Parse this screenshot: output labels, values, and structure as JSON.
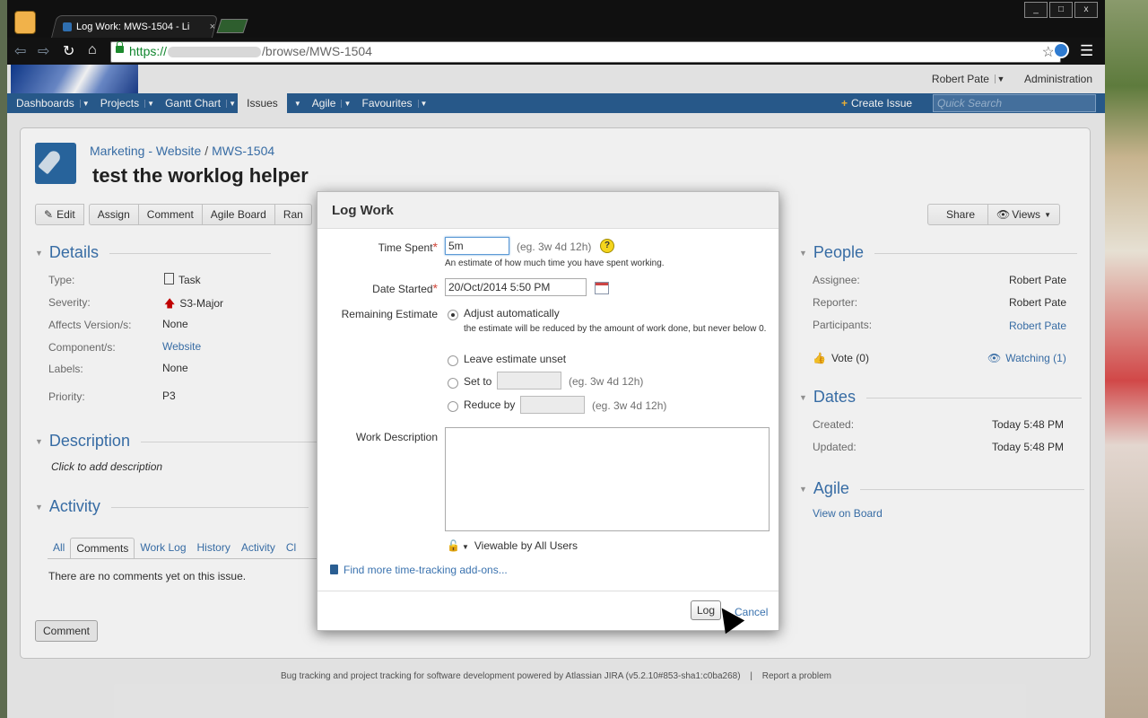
{
  "browser": {
    "tab_title": "Log Work: MWS-1504 - Li",
    "tab_close": "×",
    "url_scheme": "https://",
    "url_path": "/browse/MWS-1504",
    "window_buttons": [
      "_",
      "□",
      "x"
    ]
  },
  "header": {
    "user": "Robert Pate",
    "admin": "Administration",
    "nav": [
      "Dashboards",
      "Projects",
      "Gantt Chart",
      "Issues",
      "Agile",
      "Favourites"
    ],
    "create": "Create Issue",
    "search_placeholder": "Quick Search"
  },
  "issue": {
    "project": "Marketing - Website",
    "key": "MWS-1504",
    "summary": "test the worklog helper",
    "ops": [
      "Edit",
      "Assign",
      "Comment",
      "Agile Board",
      "Ran"
    ],
    "right_ops": [
      "Share",
      "Views"
    ],
    "details_title": "Details",
    "fields": [
      {
        "label": "Type:",
        "value": "Task"
      },
      {
        "label": "Severity:",
        "value": "S3-Major"
      },
      {
        "label": "Affects Version/s:",
        "value": "None"
      },
      {
        "label": "Component/s:",
        "value": "Website"
      },
      {
        "label": "Labels:",
        "value": "None"
      },
      {
        "label": "Priority:",
        "value": "P3"
      }
    ],
    "description_title": "Description",
    "description_placeholder": "Click to add description",
    "activity_title": "Activity",
    "activity_tabs": [
      "All",
      "Comments",
      "Work Log",
      "History",
      "Activity",
      "Cl"
    ],
    "no_comments": "There are no comments yet on this issue.",
    "comment_button": "Comment",
    "people_title": "People",
    "people": [
      {
        "label": "Assignee:",
        "value": "Robert Pate"
      },
      {
        "label": "Reporter:",
        "value": "Robert Pate"
      },
      {
        "label": "Participants:",
        "value": "Robert Pate"
      }
    ],
    "vote": "Vote (0)",
    "watching": "Watching (1)",
    "dates_title": "Dates",
    "dates": [
      {
        "label": "Created:",
        "value": "Today 5:48 PM"
      },
      {
        "label": "Updated:",
        "value": "Today 5:48 PM"
      }
    ],
    "agile_title": "Agile",
    "agile_link": "View on Board"
  },
  "dialog": {
    "title": "Log Work",
    "time_spent_label": "Time Spent",
    "time_spent_value": "5m",
    "time_spent_hint": "(eg. 3w 4d 12h)",
    "time_spent_desc": "An estimate of how much time you have spent working.",
    "date_started_label": "Date Started",
    "date_started_value": "20/Oct/2014 5:50 PM",
    "remaining_label": "Remaining Estimate",
    "opt_adjust": "Adjust automatically",
    "opt_adjust_desc": "the estimate will be reduced by the amount of work done, but never below 0.",
    "opt_unset": "Leave estimate unset",
    "opt_set": "Set to",
    "opt_set_hint": "(eg. 3w 4d 12h)",
    "opt_reduce": "Reduce by",
    "opt_reduce_hint": "(eg. 3w 4d 12h)",
    "work_desc_label": "Work Description",
    "viewable": "Viewable by All Users",
    "more_link": "Find more time-tracking add-ons...",
    "log_button": "Log",
    "cancel_link": "Cancel"
  },
  "footer": {
    "text": "Bug tracking and project tracking for software development powered by Atlassian JIRA (v5.2.10#853-sha1:c0ba268)",
    "sep": "|",
    "report": "Report a problem"
  },
  "colors": {
    "nav_bg": "#2a5e92",
    "link": "#3b73af",
    "required": "#d04437"
  }
}
